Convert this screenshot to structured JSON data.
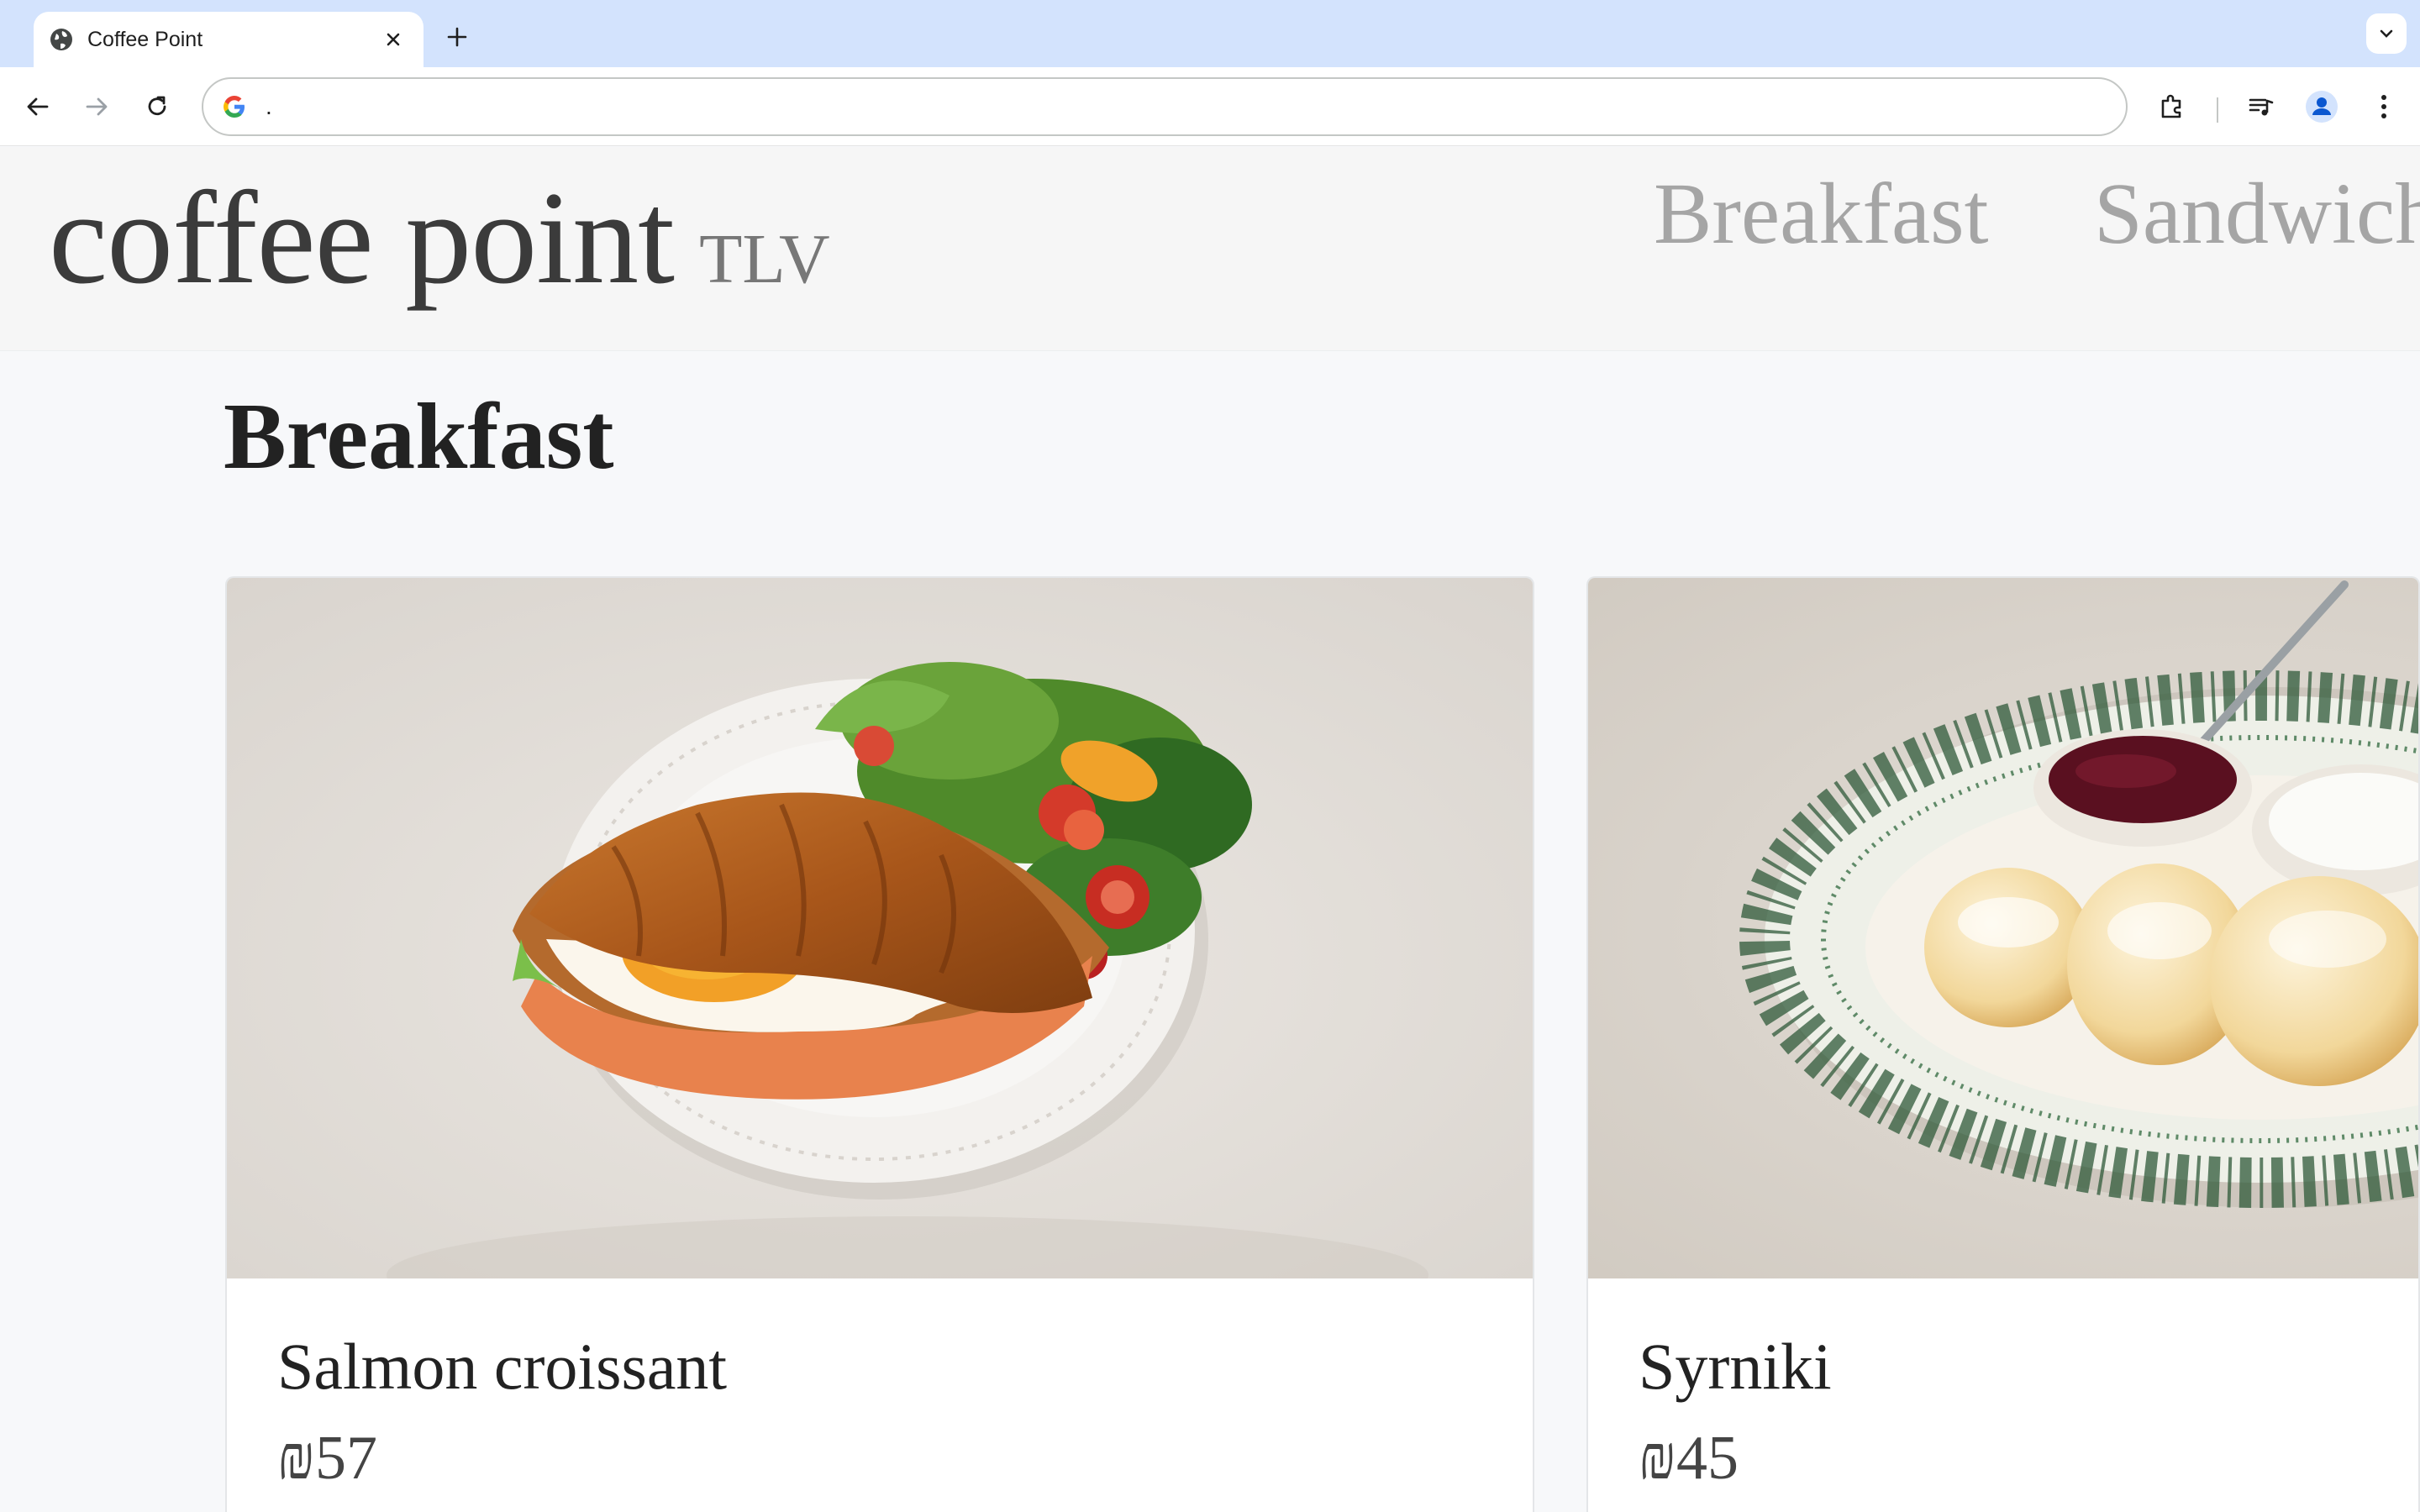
{
  "browser": {
    "tab_title": "Coffee Point",
    "address": "."
  },
  "site": {
    "logo_main": "coffee point",
    "logo_sub": "TLV",
    "nav": [
      {
        "label": "Breakfast"
      },
      {
        "label": "Sandwich"
      }
    ]
  },
  "section": {
    "title": "Breakfast",
    "items": [
      {
        "name": "Salmon croissant",
        "price": "₪57",
        "image": "salmon-croissant-plate-photo"
      },
      {
        "name": "Syrniki",
        "price": "₪45",
        "image": "syrniki-plate-photo"
      }
    ]
  }
}
